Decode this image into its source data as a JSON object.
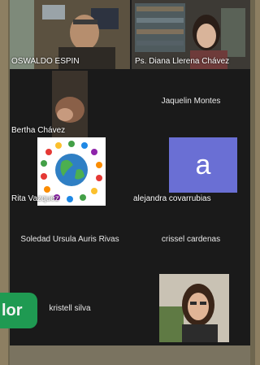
{
  "participants": [
    {
      "name": "OSWALDO ESPIN"
    },
    {
      "name": "Ps. Diana Llerena Chávez"
    },
    {
      "name": "Bertha Chávez"
    },
    {
      "name": "Jaquelin Montes"
    },
    {
      "name": "Rita Vazquez"
    },
    {
      "name": "alejandra covarrubias",
      "avatar_letter": "a"
    },
    {
      "name": "Soledad Ursula Auris Rivas"
    },
    {
      "name": "crissel cardenas"
    },
    {
      "name": "kristell silva"
    },
    {
      "name": ""
    }
  ],
  "side_chip": {
    "text": "lor"
  },
  "colors": {
    "background": "#1a1a1a",
    "avatar": "#6a6fd4",
    "chip": "#1f9a52"
  }
}
